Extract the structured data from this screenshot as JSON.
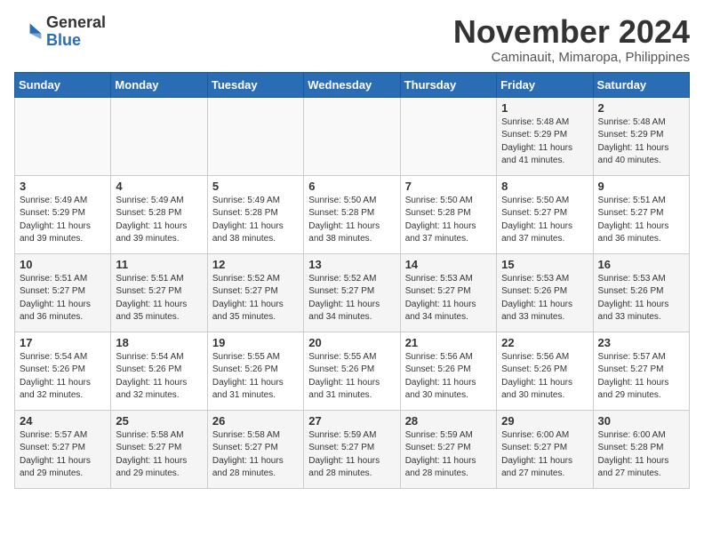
{
  "header": {
    "logo_general": "General",
    "logo_blue": "Blue",
    "month_year": "November 2024",
    "location": "Caminauit, Mimaropa, Philippines"
  },
  "weekdays": [
    "Sunday",
    "Monday",
    "Tuesday",
    "Wednesday",
    "Thursday",
    "Friday",
    "Saturday"
  ],
  "weeks": [
    [
      {
        "day": "",
        "info": ""
      },
      {
        "day": "",
        "info": ""
      },
      {
        "day": "",
        "info": ""
      },
      {
        "day": "",
        "info": ""
      },
      {
        "day": "",
        "info": ""
      },
      {
        "day": "1",
        "info": "Sunrise: 5:48 AM\nSunset: 5:29 PM\nDaylight: 11 hours\nand 41 minutes."
      },
      {
        "day": "2",
        "info": "Sunrise: 5:48 AM\nSunset: 5:29 PM\nDaylight: 11 hours\nand 40 minutes."
      }
    ],
    [
      {
        "day": "3",
        "info": "Sunrise: 5:49 AM\nSunset: 5:29 PM\nDaylight: 11 hours\nand 39 minutes."
      },
      {
        "day": "4",
        "info": "Sunrise: 5:49 AM\nSunset: 5:28 PM\nDaylight: 11 hours\nand 39 minutes."
      },
      {
        "day": "5",
        "info": "Sunrise: 5:49 AM\nSunset: 5:28 PM\nDaylight: 11 hours\nand 38 minutes."
      },
      {
        "day": "6",
        "info": "Sunrise: 5:50 AM\nSunset: 5:28 PM\nDaylight: 11 hours\nand 38 minutes."
      },
      {
        "day": "7",
        "info": "Sunrise: 5:50 AM\nSunset: 5:28 PM\nDaylight: 11 hours\nand 37 minutes."
      },
      {
        "day": "8",
        "info": "Sunrise: 5:50 AM\nSunset: 5:27 PM\nDaylight: 11 hours\nand 37 minutes."
      },
      {
        "day": "9",
        "info": "Sunrise: 5:51 AM\nSunset: 5:27 PM\nDaylight: 11 hours\nand 36 minutes."
      }
    ],
    [
      {
        "day": "10",
        "info": "Sunrise: 5:51 AM\nSunset: 5:27 PM\nDaylight: 11 hours\nand 36 minutes."
      },
      {
        "day": "11",
        "info": "Sunrise: 5:51 AM\nSunset: 5:27 PM\nDaylight: 11 hours\nand 35 minutes."
      },
      {
        "day": "12",
        "info": "Sunrise: 5:52 AM\nSunset: 5:27 PM\nDaylight: 11 hours\nand 35 minutes."
      },
      {
        "day": "13",
        "info": "Sunrise: 5:52 AM\nSunset: 5:27 PM\nDaylight: 11 hours\nand 34 minutes."
      },
      {
        "day": "14",
        "info": "Sunrise: 5:53 AM\nSunset: 5:27 PM\nDaylight: 11 hours\nand 34 minutes."
      },
      {
        "day": "15",
        "info": "Sunrise: 5:53 AM\nSunset: 5:26 PM\nDaylight: 11 hours\nand 33 minutes."
      },
      {
        "day": "16",
        "info": "Sunrise: 5:53 AM\nSunset: 5:26 PM\nDaylight: 11 hours\nand 33 minutes."
      }
    ],
    [
      {
        "day": "17",
        "info": "Sunrise: 5:54 AM\nSunset: 5:26 PM\nDaylight: 11 hours\nand 32 minutes."
      },
      {
        "day": "18",
        "info": "Sunrise: 5:54 AM\nSunset: 5:26 PM\nDaylight: 11 hours\nand 32 minutes."
      },
      {
        "day": "19",
        "info": "Sunrise: 5:55 AM\nSunset: 5:26 PM\nDaylight: 11 hours\nand 31 minutes."
      },
      {
        "day": "20",
        "info": "Sunrise: 5:55 AM\nSunset: 5:26 PM\nDaylight: 11 hours\nand 31 minutes."
      },
      {
        "day": "21",
        "info": "Sunrise: 5:56 AM\nSunset: 5:26 PM\nDaylight: 11 hours\nand 30 minutes."
      },
      {
        "day": "22",
        "info": "Sunrise: 5:56 AM\nSunset: 5:26 PM\nDaylight: 11 hours\nand 30 minutes."
      },
      {
        "day": "23",
        "info": "Sunrise: 5:57 AM\nSunset: 5:27 PM\nDaylight: 11 hours\nand 29 minutes."
      }
    ],
    [
      {
        "day": "24",
        "info": "Sunrise: 5:57 AM\nSunset: 5:27 PM\nDaylight: 11 hours\nand 29 minutes."
      },
      {
        "day": "25",
        "info": "Sunrise: 5:58 AM\nSunset: 5:27 PM\nDaylight: 11 hours\nand 29 minutes."
      },
      {
        "day": "26",
        "info": "Sunrise: 5:58 AM\nSunset: 5:27 PM\nDaylight: 11 hours\nand 28 minutes."
      },
      {
        "day": "27",
        "info": "Sunrise: 5:59 AM\nSunset: 5:27 PM\nDaylight: 11 hours\nand 28 minutes."
      },
      {
        "day": "28",
        "info": "Sunrise: 5:59 AM\nSunset: 5:27 PM\nDaylight: 11 hours\nand 28 minutes."
      },
      {
        "day": "29",
        "info": "Sunrise: 6:00 AM\nSunset: 5:27 PM\nDaylight: 11 hours\nand 27 minutes."
      },
      {
        "day": "30",
        "info": "Sunrise: 6:00 AM\nSunset: 5:28 PM\nDaylight: 11 hours\nand 27 minutes."
      }
    ]
  ]
}
